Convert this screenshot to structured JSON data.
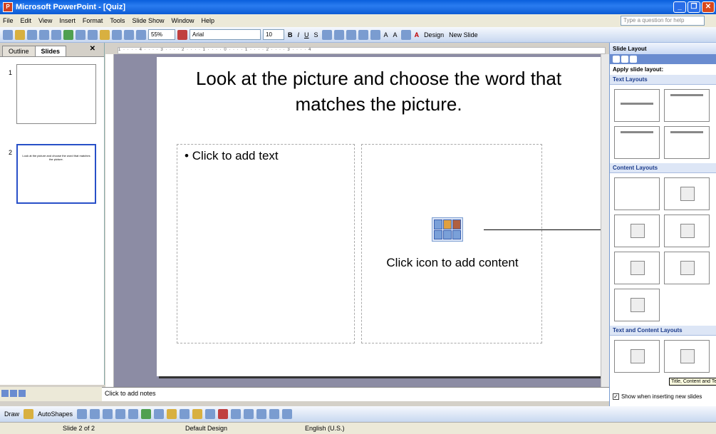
{
  "window": {
    "title": "Microsoft PowerPoint - [Quiz]"
  },
  "menu": [
    "File",
    "Edit",
    "View",
    "Insert",
    "Format",
    "Tools",
    "Slide Show",
    "Window",
    "Help"
  ],
  "help_box": {
    "placeholder": "Type a question for help"
  },
  "toolbar": {
    "zoom": "55%",
    "font": "Arial",
    "font_size": "10",
    "design_label": "Design",
    "new_slide_label": "New Slide"
  },
  "left_pane": {
    "tabs": [
      "Outline",
      "Slides"
    ],
    "active_tab": "Slides",
    "slide_numbers": [
      "1",
      "2"
    ],
    "thumb2_text": "Look at the picture and choose the word that matches the picture."
  },
  "slide": {
    "title": "Look at the picture and choose the word that matches the picture.",
    "left_placeholder": "Click to add text",
    "right_placeholder": "Click icon to add content"
  },
  "task_pane": {
    "title": "Slide Layout",
    "apply_label": "Apply slide layout:",
    "sections": [
      "Text Layouts",
      "Content Layouts",
      "Text and Content Layouts"
    ],
    "show_checkbox": "Show when inserting new slides",
    "tooltip": "Title, Content and Te"
  },
  "notes": {
    "placeholder": "Click to add notes"
  },
  "drawing": {
    "draw_label": "Draw",
    "autoshapes_label": "AutoShapes"
  },
  "status": {
    "slide": "Slide 2 of 2",
    "design": "Default Design",
    "language": "English (U.S.)"
  }
}
